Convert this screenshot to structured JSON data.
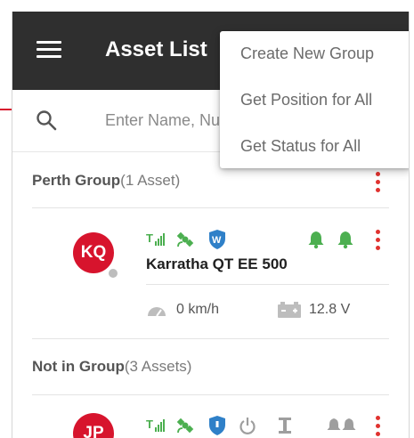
{
  "header": {
    "title": "Asset List"
  },
  "search": {
    "placeholder": "Enter Name, Number"
  },
  "menu": {
    "items": [
      "Create New Group",
      "Get Position for All",
      "Get Status for All"
    ]
  },
  "groups": [
    {
      "name": "Perth Group",
      "count": "(1 Asset)",
      "assets": [
        {
          "initials": "KQ",
          "name": "Karratha QT EE 500",
          "speed": "0 km/h",
          "voltage": "12.8 V"
        }
      ]
    },
    {
      "name": "Not in Group",
      "count": "(3 Assets)",
      "assets": [
        {
          "initials": "JP"
        }
      ]
    }
  ],
  "colors": {
    "appbar": "#2f2f2f",
    "accent": "#e0322f",
    "avatar": "#d7142d",
    "green": "#4caf50",
    "blue": "#2f80c8",
    "grey": "#9e9e9e"
  }
}
